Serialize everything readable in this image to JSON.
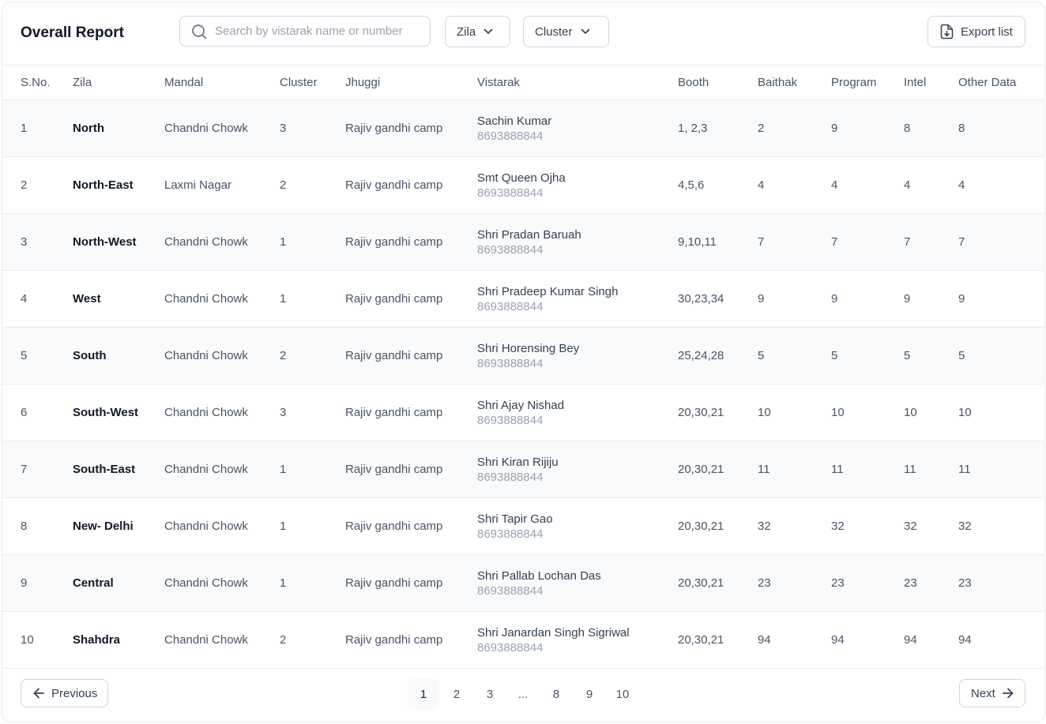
{
  "header": {
    "title": "Overall Report",
    "search_placeholder": "Search by vistarak name or number",
    "zila_filter": "Zila",
    "cluster_filter": "Cluster",
    "export_label": "Export list"
  },
  "table": {
    "columns": [
      "S.No.",
      "Zila",
      "Mandal",
      "Cluster",
      "Jhuggi",
      "Vistarak",
      "Booth",
      "Baithak",
      "Program",
      "Intel",
      "Other Data"
    ],
    "rows": [
      {
        "sno": "1",
        "zila": "North",
        "mandal": "Chandni Chowk",
        "cluster": "3",
        "jhuggi": "Rajiv gandhi camp",
        "vistarak_name": "Sachin Kumar",
        "vistarak_phone": "8693888844",
        "booth": "1, 2,3",
        "baithak": "2",
        "program": "9",
        "intel": "8",
        "other": "8"
      },
      {
        "sno": "2",
        "zila": "North-East",
        "mandal": "Laxmi Nagar",
        "cluster": "2",
        "jhuggi": "Rajiv gandhi camp",
        "vistarak_name": "Smt Queen Ojha",
        "vistarak_phone": "8693888844",
        "booth": "4,5,6",
        "baithak": "4",
        "program": "4",
        "intel": "4",
        "other": "4"
      },
      {
        "sno": "3",
        "zila": "North-West",
        "mandal": "Chandni Chowk",
        "cluster": "1",
        "jhuggi": "Rajiv gandhi camp",
        "vistarak_name": "Shri Pradan Baruah",
        "vistarak_phone": "8693888844",
        "booth": "9,10,11",
        "baithak": "7",
        "program": "7",
        "intel": "7",
        "other": "7"
      },
      {
        "sno": "4",
        "zila": "West",
        "mandal": "Chandni Chowk",
        "cluster": "1",
        "jhuggi": "Rajiv gandhi camp",
        "vistarak_name": "Shri Pradeep Kumar Singh",
        "vistarak_phone": "8693888844",
        "booth": "30,23,34",
        "baithak": "9",
        "program": "9",
        "intel": "9",
        "other": "9"
      },
      {
        "sno": "5",
        "zila": "South",
        "mandal": "Chandni Chowk",
        "cluster": "2",
        "jhuggi": "Rajiv gandhi camp",
        "vistarak_name": "Shri Horensing Bey",
        "vistarak_phone": "8693888844",
        "booth": "25,24,28",
        "baithak": "5",
        "program": "5",
        "intel": "5",
        "other": "5"
      },
      {
        "sno": "6",
        "zila": "South-West",
        "mandal": "Chandni Chowk",
        "cluster": "3",
        "jhuggi": "Rajiv gandhi camp",
        "vistarak_name": "Shri Ajay Nishad",
        "vistarak_phone": "8693888844",
        "booth": "20,30,21",
        "baithak": "10",
        "program": "10",
        "intel": "10",
        "other": "10"
      },
      {
        "sno": "7",
        "zila": "South-East",
        "mandal": "Chandni Chowk",
        "cluster": "1",
        "jhuggi": "Rajiv gandhi camp",
        "vistarak_name": "Shri Kiran Rijiju",
        "vistarak_phone": "8693888844",
        "booth": "20,30,21",
        "baithak": "11",
        "program": "11",
        "intel": "11",
        "other": "11"
      },
      {
        "sno": "8",
        "zila": "New- Delhi",
        "mandal": "Chandni Chowk",
        "cluster": "1",
        "jhuggi": "Rajiv gandhi camp",
        "vistarak_name": "Shri Tapir Gao",
        "vistarak_phone": "8693888844",
        "booth": "20,30,21",
        "baithak": "32",
        "program": "32",
        "intel": "32",
        "other": "32"
      },
      {
        "sno": "9",
        "zila": "Central",
        "mandal": "Chandni Chowk",
        "cluster": "1",
        "jhuggi": "Rajiv gandhi camp",
        "vistarak_name": "Shri Pallab Lochan Das",
        "vistarak_phone": "8693888844",
        "booth": "20,30,21",
        "baithak": "23",
        "program": "23",
        "intel": "23",
        "other": "23"
      },
      {
        "sno": "10",
        "zila": "Shahdra",
        "mandal": "Chandni Chowk",
        "cluster": "2",
        "jhuggi": "Rajiv gandhi camp",
        "vistarak_name": "Shri Janardan Singh Sigriwal",
        "vistarak_phone": "8693888844",
        "booth": "20,30,21",
        "baithak": "94",
        "program": "94",
        "intel": "94",
        "other": "94"
      }
    ]
  },
  "pagination": {
    "previous_label": "Previous",
    "next_label": "Next",
    "pages": [
      "1",
      "2",
      "3",
      "...",
      "8",
      "9",
      "10"
    ],
    "active_page": "1"
  },
  "icons": {
    "search": "search-icon",
    "chevron": "chevron-down-icon",
    "export": "download-file-icon",
    "prev": "arrow-left-icon",
    "next": "arrow-right-icon"
  },
  "colors": {
    "text_primary": "#101828",
    "text_secondary": "#475467",
    "phone_text": "#98a2b3",
    "border": "#d0d5dd",
    "row_alt_bg": "#f9fafb"
  }
}
